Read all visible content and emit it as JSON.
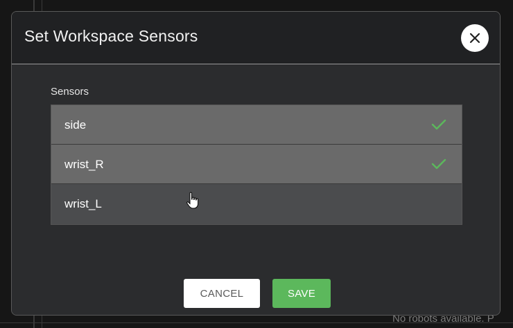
{
  "modal": {
    "title": "Set Workspace Sensors",
    "close_icon": "close-icon"
  },
  "sensors": {
    "label": "Sensors",
    "items": [
      {
        "name": "side",
        "selected": true
      },
      {
        "name": "wrist_R",
        "selected": true
      },
      {
        "name": "wrist_L",
        "selected": false
      }
    ]
  },
  "buttons": {
    "cancel_label": "CANCEL",
    "save_label": "SAVE"
  },
  "background": {
    "status_text": "No robots available. P"
  },
  "colors": {
    "check": "#5cb85c",
    "save": "#5cb85c",
    "selected_row": "#6a6a6a",
    "unselected_row": "#4b4c4e"
  }
}
